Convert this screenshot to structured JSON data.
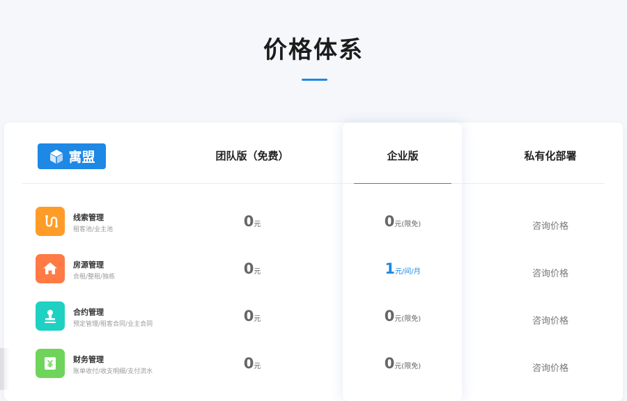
{
  "page": {
    "title": "价格体系"
  },
  "logo": {
    "text": "寓盟"
  },
  "plans": [
    {
      "name": "团队版（免费）"
    },
    {
      "name": "企业版"
    },
    {
      "name": "私有化部署"
    }
  ],
  "features": [
    {
      "name": "线索管理",
      "desc": "租客池/业主池",
      "icon": "clue-icon",
      "color": "#ff9c27",
      "team": {
        "num": "0",
        "unit": "元"
      },
      "enterprise": {
        "num": "0",
        "unit": "元(限免)"
      },
      "private": "咨询价格"
    },
    {
      "name": "房源管理",
      "desc": "合租/整租/独栋",
      "icon": "house-icon",
      "color": "#ff7a45",
      "team": {
        "num": "0",
        "unit": "元"
      },
      "enterprise": {
        "num": "1",
        "unit": "元/间/月"
      },
      "private": "咨询价格"
    },
    {
      "name": "合约管理",
      "desc": "预定管理/租客合同/业主合同",
      "icon": "stamp-icon",
      "color": "#1fd1c3",
      "team": {
        "num": "0",
        "unit": "元"
      },
      "enterprise": {
        "num": "0",
        "unit": "元(限免)"
      },
      "private": "咨询价格"
    },
    {
      "name": "财务管理",
      "desc": "账单收付/收支明细/支付流水",
      "icon": "finance-icon",
      "color": "#6fd45b",
      "team": {
        "num": "0",
        "unit": "元"
      },
      "enterprise": {
        "num": "0",
        "unit": "元(限免)"
      },
      "private": "咨询价格"
    }
  ],
  "colors": {
    "accent": "#1e88e5",
    "background": "#f5f7fb"
  }
}
